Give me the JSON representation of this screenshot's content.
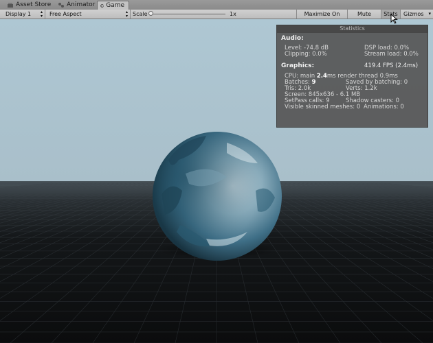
{
  "tabs": [
    {
      "label": "Asset Store",
      "icon": "store-icon",
      "active": false
    },
    {
      "label": "Animator",
      "icon": "animator-icon",
      "active": false
    },
    {
      "label": "Game",
      "icon": "game-controller-icon",
      "active": true
    }
  ],
  "toolbar": {
    "display": "Display 1",
    "aspect": "Free Aspect",
    "scale_label": "Scale",
    "scale_value": "1x",
    "scale_fraction": 0.0,
    "maximize_on_play": "Maximize On Play",
    "mute_audio": "Mute Audio",
    "stats": "Stats",
    "stats_pressed": true,
    "gizmos": "Gizmos"
  },
  "stats": {
    "title": "Statistics",
    "audio_header": "Audio:",
    "level": "Level: -74.8 dB",
    "dsp_load": "DSP load: 0.0%",
    "clipping": "Clipping: 0.0%",
    "stream_load": "Stream load: 0.0%",
    "graphics_header": "Graphics:",
    "fps": "419.4 FPS (2.4ms)",
    "cpu_prefix": "CPU: main ",
    "cpu_main": "2.4",
    "cpu_suffix": "ms  render thread 0.9ms",
    "batches_prefix": "Batches: ",
    "batches": "9",
    "saved_by_batching": "Saved by batching: 0",
    "tris": "Tris: 2.0k",
    "verts": "Verts: 1.2k",
    "screen": "Screen: 845x636 - 6.1 MB",
    "setpass": "SetPass calls: 9",
    "shadow_casters": "Shadow casters: 0",
    "skinned_meshes": "Visible skinned meshes: 0",
    "animations": "Animations: 0"
  },
  "colors": {
    "sky": "#aec6d2",
    "ground": "#0e1012",
    "sphere_dark": "#1e3a4c",
    "sphere_light": "#c9d8df",
    "stats_bg": "#565656"
  }
}
